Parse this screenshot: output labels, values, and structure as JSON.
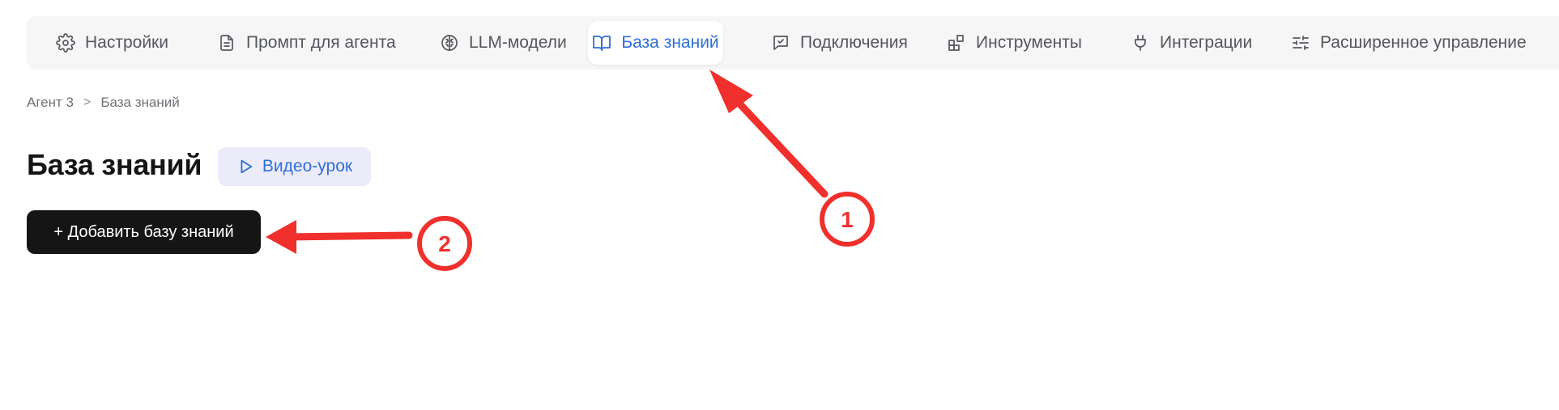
{
  "tabs": [
    {
      "label": "Настройки",
      "icon": "gear-icon",
      "active": false
    },
    {
      "label": "Промпт для агента",
      "icon": "document-icon",
      "active": false
    },
    {
      "label": "LLM-модели",
      "icon": "brain-icon",
      "active": false
    },
    {
      "label": "База знаний",
      "icon": "book-icon",
      "active": true
    },
    {
      "label": "Подключения",
      "icon": "chat-check-icon",
      "active": false
    },
    {
      "label": "Инструменты",
      "icon": "blocks-icon",
      "active": false
    },
    {
      "label": "Интеграции",
      "icon": "plug-icon",
      "active": false
    },
    {
      "label": "Расширенное управление",
      "icon": "sliders-icon",
      "active": false
    }
  ],
  "breadcrumb": {
    "parent": "Агент 3",
    "separator": ">",
    "current": "База знаний"
  },
  "page": {
    "title": "База знаний",
    "video_label": "Видео-урок",
    "add_label": "+ Добавить базу знаний"
  },
  "annotations": {
    "marker_1": "1",
    "marker_2": "2",
    "color": "#f0302c"
  },
  "colors": {
    "accent": "#2f6fd6",
    "tabbar_bg": "#f6f6f7",
    "primary_button": "#151515",
    "video_button_bg": "#ebebfa"
  }
}
